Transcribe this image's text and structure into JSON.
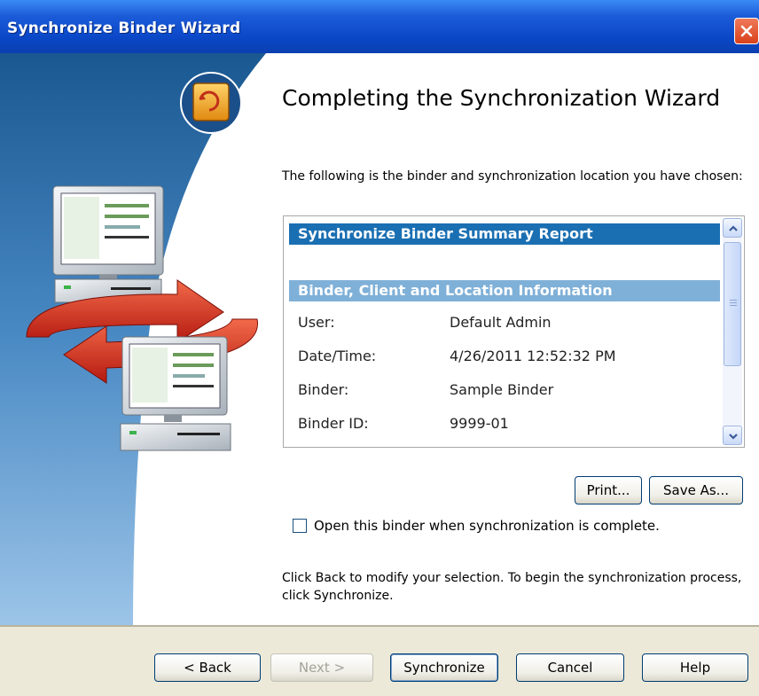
{
  "window": {
    "title": "Synchronize Binder Wizard",
    "close_icon": "close-icon"
  },
  "page": {
    "heading": "Completing the Synchronization Wizard",
    "intro": "The following is the binder and synchronization location you have chosen:"
  },
  "report": {
    "title": "Synchronize Binder Summary Report",
    "section": "Binder, Client and Location Information",
    "rows": [
      {
        "key": "User:",
        "value": "Default Admin"
      },
      {
        "key": "Date/Time:",
        "value": "4/26/2011 12:52:32 PM"
      },
      {
        "key": "Binder:",
        "value": "Sample Binder"
      },
      {
        "key": "Binder ID:",
        "value": "9999-01"
      }
    ]
  },
  "report_buttons": {
    "print": "Print...",
    "save_as": "Save As..."
  },
  "checkbox": {
    "label": "Open this binder when synchronization is complete.",
    "checked": false
  },
  "footer_text": "Click Back to modify your selection. To begin the synchronization process, click Synchronize.",
  "buttons": {
    "back": "< Back",
    "next": "Next >",
    "synchronize": "Synchronize",
    "cancel": "Cancel",
    "help": "Help"
  },
  "colors": {
    "titlebar": "#0a48c8",
    "report_header": "#1a6fb2",
    "report_section": "#7fb0d8",
    "banner_blue": "#1e5f9a"
  }
}
